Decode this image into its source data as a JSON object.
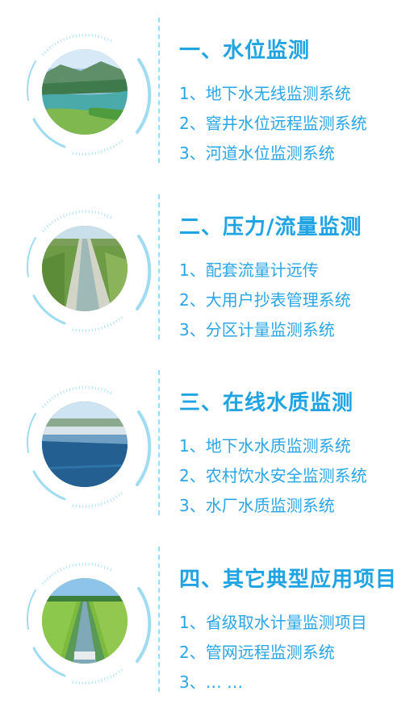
{
  "sections": [
    {
      "title": "一、水位监测",
      "image": "river-valley-photo",
      "items": [
        "1、地下水无线监测系统",
        "2、窨井水位远程监测系统",
        "3、河道水位监测系统"
      ]
    },
    {
      "title": "二、压力/流量监测",
      "image": "irrigation-canal-photo",
      "items": [
        "1、配套流量计远传",
        "2、大用户抄表管理系统",
        "3、分区计量监测系统"
      ]
    },
    {
      "title": "三、在线水质监测",
      "image": "water-plant-pool-photo",
      "items": [
        "1、地下水水质监测系统",
        "2、农村饮水安全监测系统",
        "3、水厂水质监测系统"
      ]
    },
    {
      "title": "四、其它典型应用项目",
      "image": "farmland-channel-photo",
      "items": [
        "1、省级取水计量监测项目",
        "2、管网远程监测系统",
        "3、… …"
      ]
    }
  ],
  "colors": {
    "accent": "#1fa3e3",
    "ring": "#9fdcf2"
  }
}
